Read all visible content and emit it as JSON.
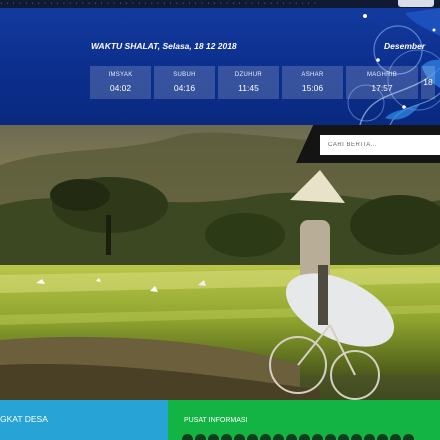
{
  "prayer": {
    "title": "WAKTU SHALAT, Selasa, 18 12 2018",
    "month": "Desember",
    "times": [
      {
        "name": "IMSYAK",
        "time": "04:02"
      },
      {
        "name": "SUBUH",
        "time": "04:16"
      },
      {
        "name": "DZUHUR",
        "time": "11:45"
      },
      {
        "name": "ASHAR",
        "time": "15:06"
      },
      {
        "name": "MAGHRIB",
        "time": "17:57"
      },
      {
        "name": "",
        "time": "18"
      }
    ]
  },
  "search": {
    "placeholder": "CARI BERITA..."
  },
  "footer": {
    "left_label": "GKAT DESA",
    "right_label": "PUSAT INFORMASI"
  },
  "colors": {
    "banner_blue": "#0b2d8a",
    "footer_left": "#27a3d6",
    "footer_right": "#13b344"
  }
}
